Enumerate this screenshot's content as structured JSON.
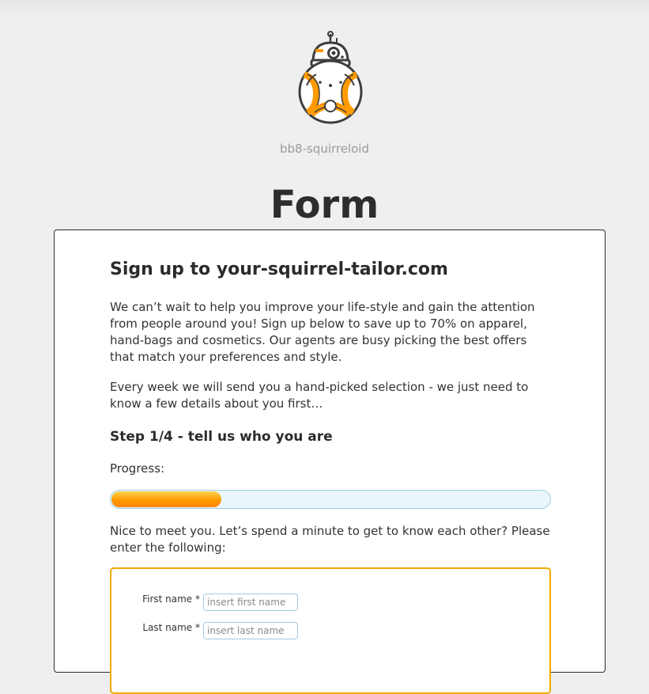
{
  "brand": {
    "name": "bb8-squirreloid"
  },
  "page": {
    "title": "Form"
  },
  "signup": {
    "title": "Sign up to your-squirrel-tailor.com",
    "intro": "We can’t wait to help you improve your life-style and gain the attention from people around you! Sign up below to save up to 70% on apparel, hand-bags and cosmetics. Our agents are busy picking the best offers that match your preferences and style.",
    "weekly": "Every week we will send you a hand-picked selection - we just need to know a few details about you first…",
    "step_title": "Step 1/4 - tell us who you are",
    "progress_label": "Progress:",
    "progress_fraction": 0.25,
    "meet_text": "Nice to meet you. Let’s spend a minute to get to know each other? Please enter the following:"
  },
  "form": {
    "first_name": {
      "label": "First name *",
      "placeholder": "insert first name",
      "value": ""
    },
    "last_name": {
      "label": "Last name *",
      "placeholder": "insert last name",
      "value": ""
    }
  },
  "colors": {
    "accent_orange": "#ff9a00",
    "form_border": "#f2a900",
    "input_border": "#9fcbe0",
    "progress_track": "#e9f6fb"
  },
  "icons": {
    "logo": "bb8-droid-icon"
  }
}
